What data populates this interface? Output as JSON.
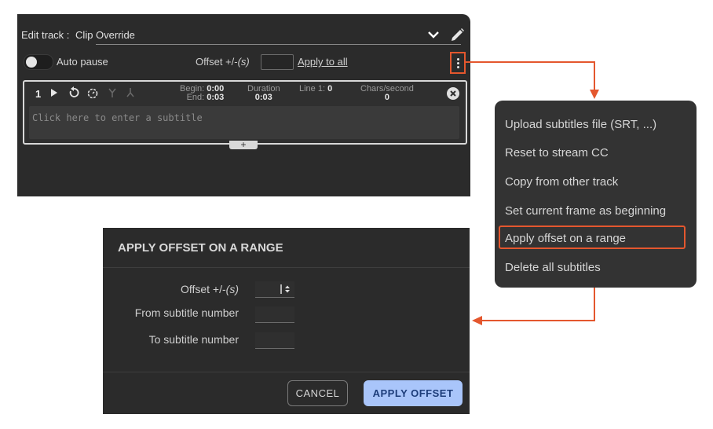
{
  "editor": {
    "track_label": "Edit track :",
    "track_value": "Clip Override",
    "auto_pause": "Auto pause",
    "offset_label": "Offset +/-",
    "offset_unit": "(s)",
    "apply_to_all": "Apply to all",
    "subtitle": {
      "number": "1",
      "begin_label": "Begin:",
      "begin_value": "0:00",
      "end_label": "End:",
      "end_value": "0:03",
      "duration_label": "Duration",
      "duration_value": "0:03",
      "line_label": "Line 1:",
      "line_value": "0",
      "cps_label": "Chars/second",
      "cps_value": "0",
      "placeholder": "Click here to enter a subtitle"
    },
    "add_label": "+"
  },
  "menu": {
    "items": [
      "Upload subtitles file (SRT, ...)",
      "Reset to stream CC",
      "Copy from other track",
      "Set current frame as beginning",
      "Apply offset on a range",
      "Delete all subtitles"
    ]
  },
  "dialog": {
    "title": "APPLY OFFSET ON A RANGE",
    "offset_label": "Offset +/-",
    "offset_unit": "(s)",
    "from_label": "From subtitle number",
    "to_label": "To subtitle number",
    "cancel": "CANCEL",
    "apply": "APPLY OFFSET"
  },
  "colors": {
    "panel": "#2b2b2b",
    "highlight": "#e4572e",
    "primary_button": "#a9c5fa"
  },
  "icons": [
    "chevron-down-icon",
    "pencil-icon",
    "more-vertical-icon",
    "play-icon",
    "undo-icon",
    "timer-icon",
    "split-icon",
    "merge-icon",
    "close-circle-icon",
    "stepper-icon"
  ]
}
